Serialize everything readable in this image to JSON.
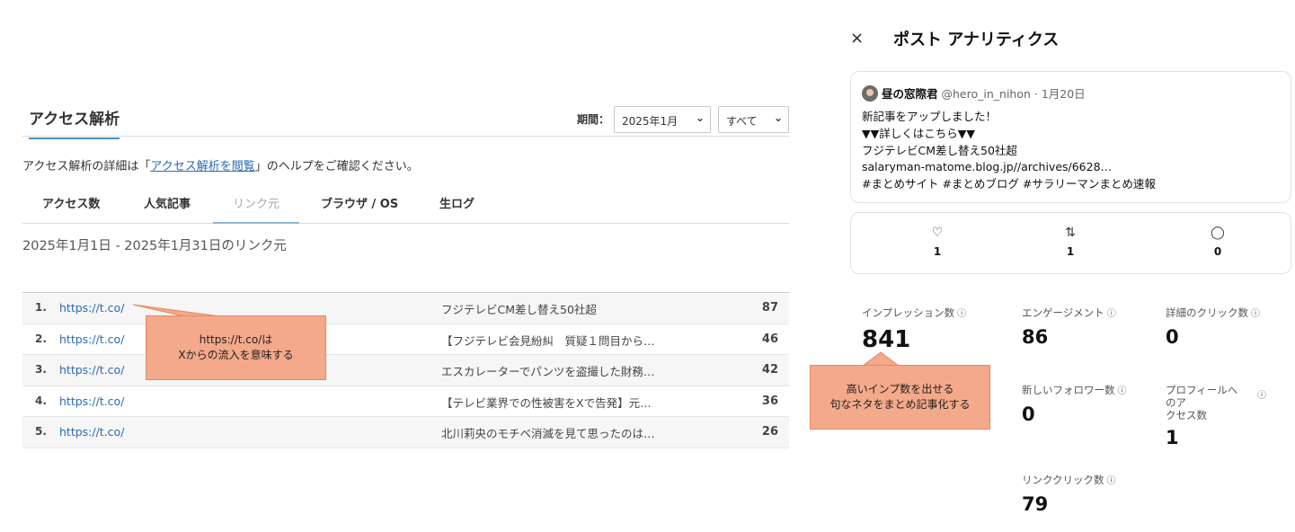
{
  "left": {
    "title": "アクセス解析",
    "period_label": "期間：",
    "period_month": "2025年1月",
    "period_scope": "すべて",
    "help": {
      "prefix": "アクセス解析の詳細は「",
      "link": "アクセス解析を閲覧",
      "suffix": "」のヘルプをご確認ください。"
    },
    "tabs": [
      "アクセス数",
      "人気記事",
      "リンク元",
      "ブラウザ / OS",
      "生ログ"
    ],
    "range": "2025年1月1日 - 2025年1月31日のリンク元",
    "rows": [
      {
        "num": "1.",
        "url": "https://t.co/",
        "title": "フジテレビCM差し替え50社超",
        "count": "87"
      },
      {
        "num": "2.",
        "url": "https://t.co/",
        "title": "【フジテレビ会見紛糾　質疑１問目から…",
        "count": "46"
      },
      {
        "num": "3.",
        "url": "https://t.co/",
        "title": "エスカレーターでパンツを盗撮した財務…",
        "count": "42"
      },
      {
        "num": "4.",
        "url": "https://t.co/",
        "title": "【テレビ業界での性被害をXで告発】元…",
        "count": "36"
      },
      {
        "num": "5.",
        "url": "https://t.co/",
        "title": "北川莉央のモチベ消滅を見て思ったのは…",
        "count": "26"
      }
    ]
  },
  "callouts": {
    "one_line1": "https://t.co/は",
    "one_line2": "Xからの流入を意味する",
    "two_line1": "高いインプ数を出せる",
    "two_line2": "句なネタをまとめ記事化する"
  },
  "right": {
    "close": "×",
    "title": "ポスト アナリティクス",
    "tweet": {
      "name": "昼の窓際君",
      "handle": "@hero_in_nihon · 1月20日",
      "body": "新記事をアップしました！\n▼▼詳しくはこちら▼▼\nフジテレビCM差し替え50社超\nsalaryman-matome.blog.jp//archives/6628…\n#まとめサイト #まとめブログ #サラリーマンまとめ速報"
    },
    "stats": {
      "likes": "1",
      "reposts": "1",
      "replies": "0"
    },
    "metrics": {
      "impressions_label": "インプレッション数",
      "impressions": "841",
      "engagement_label": "エンゲージメント",
      "engagement": "86",
      "detail_clicks_label": "詳細のクリック数",
      "detail_clicks": "0",
      "new_followers_label": "新しいフォロワー数",
      "new_followers": "0",
      "profile_label": "プロフィールへのア\nクセス数",
      "profile": "1",
      "link_clicks_label": "リンククリック数",
      "link_clicks": "79",
      "info_icon": "ⓘ"
    }
  }
}
